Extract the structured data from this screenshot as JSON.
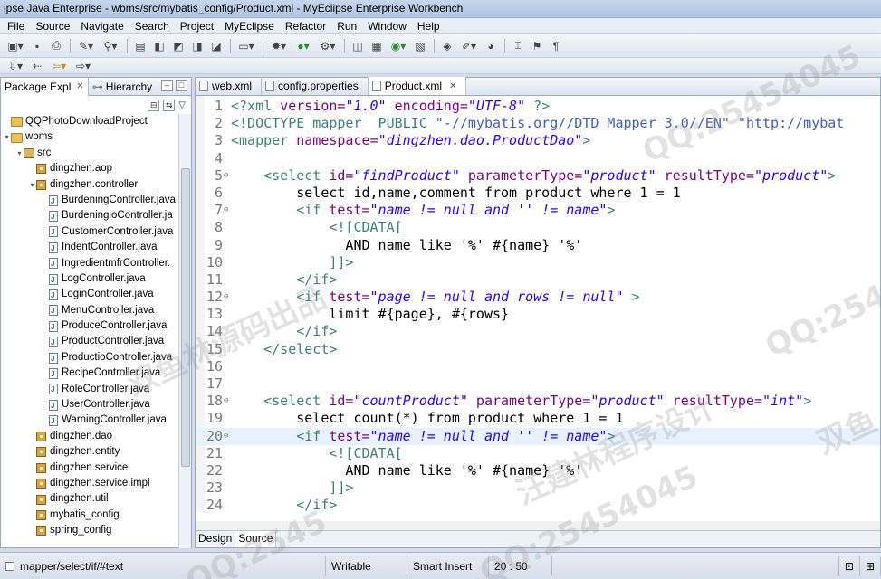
{
  "window": {
    "title": "ipse Java Enterprise - wbms/src/mybatis_config/Product.xml - MyEclipse Enterprise Workbench"
  },
  "menu": [
    "File",
    "Source",
    "Navigate",
    "Search",
    "Project",
    "MyEclipse",
    "Refactor",
    "Run",
    "Window",
    "Help"
  ],
  "left_panel": {
    "tabs": [
      {
        "label": "Package Expl",
        "close": "✕"
      },
      {
        "label": "Hierarchy"
      }
    ],
    "tree": [
      {
        "label": "QQPhotoDownloadProject",
        "indent": 0,
        "icon": "project-icon",
        "twisty": ""
      },
      {
        "label": "wbms",
        "indent": 0,
        "icon": "project-icon",
        "twisty": "▾"
      },
      {
        "label": "src",
        "indent": 1,
        "icon": "source-folder-icon",
        "twisty": "▾"
      },
      {
        "label": "dingzhen.aop",
        "indent": 2,
        "icon": "package-icon",
        "twisty": ""
      },
      {
        "label": "dingzhen.controller",
        "indent": 2,
        "icon": "package-icon",
        "twisty": "▾"
      },
      {
        "label": "BurdeningController.java",
        "indent": 3,
        "icon": "java-file-icon",
        "twisty": ""
      },
      {
        "label": "BurdeningioController.ja",
        "indent": 3,
        "icon": "java-file-icon",
        "twisty": ""
      },
      {
        "label": "CustomerController.java",
        "indent": 3,
        "icon": "java-file-icon",
        "twisty": ""
      },
      {
        "label": "IndentController.java",
        "indent": 3,
        "icon": "java-file-icon",
        "twisty": ""
      },
      {
        "label": "IngredientmfrController.",
        "indent": 3,
        "icon": "java-file-icon",
        "twisty": ""
      },
      {
        "label": "LogController.java",
        "indent": 3,
        "icon": "java-file-icon",
        "twisty": ""
      },
      {
        "label": "LoginController.java",
        "indent": 3,
        "icon": "java-file-icon",
        "twisty": ""
      },
      {
        "label": "MenuController.java",
        "indent": 3,
        "icon": "java-file-icon",
        "twisty": ""
      },
      {
        "label": "ProduceController.java",
        "indent": 3,
        "icon": "java-file-icon",
        "twisty": ""
      },
      {
        "label": "ProductController.java",
        "indent": 3,
        "icon": "java-file-icon",
        "twisty": ""
      },
      {
        "label": "ProductioController.java",
        "indent": 3,
        "icon": "java-file-icon",
        "twisty": ""
      },
      {
        "label": "RecipeController.java",
        "indent": 3,
        "icon": "java-file-icon",
        "twisty": ""
      },
      {
        "label": "RoleController.java",
        "indent": 3,
        "icon": "java-file-icon",
        "twisty": ""
      },
      {
        "label": "UserController.java",
        "indent": 3,
        "icon": "java-file-icon",
        "twisty": ""
      },
      {
        "label": "WarningController.java",
        "indent": 3,
        "icon": "java-file-icon",
        "twisty": ""
      },
      {
        "label": "dingzhen.dao",
        "indent": 2,
        "icon": "package-icon",
        "twisty": ""
      },
      {
        "label": "dingzhen.entity",
        "indent": 2,
        "icon": "package-icon",
        "twisty": ""
      },
      {
        "label": "dingzhen.service",
        "indent": 2,
        "icon": "package-icon",
        "twisty": ""
      },
      {
        "label": "dingzhen.service.impl",
        "indent": 2,
        "icon": "package-icon",
        "twisty": ""
      },
      {
        "label": "dingzhen.util",
        "indent": 2,
        "icon": "package-icon",
        "twisty": ""
      },
      {
        "label": "mybatis_config",
        "indent": 2,
        "icon": "package-icon",
        "twisty": ""
      },
      {
        "label": "spring_config",
        "indent": 2,
        "icon": "package-icon",
        "twisty": ""
      }
    ]
  },
  "editor": {
    "tabs": [
      {
        "label": "web.xml",
        "active": false
      },
      {
        "label": "config.properties",
        "active": false
      },
      {
        "label": "Product.xml",
        "active": true,
        "close": "✕"
      }
    ],
    "highlighted_line": 20,
    "lines": [
      {
        "n": "1",
        "fold": "",
        "tokens": [
          [
            "t-pi",
            "<?xml "
          ],
          [
            "t-attr",
            "version="
          ],
          [
            "t-str",
            "\"1.0\""
          ],
          [
            "t-attr",
            " encoding="
          ],
          [
            "t-str",
            "\"UTF-8\""
          ],
          [
            "t-pi",
            " ?>"
          ]
        ]
      },
      {
        "n": "2",
        "fold": "",
        "tokens": [
          [
            "t-doc",
            "<!DOCTYPE mapper  PUBLIC "
          ],
          [
            "t-docs",
            "\"-//mybatis.org//DTD Mapper 3.0//EN\""
          ],
          [
            "t-doc",
            " "
          ],
          [
            "t-docs",
            "\"http://mybat"
          ]
        ]
      },
      {
        "n": "3",
        "fold": "",
        "tokens": [
          [
            "t-tag",
            "<mapper "
          ],
          [
            "t-attr",
            "namespace="
          ],
          [
            "t-str",
            "\"dingzhen.dao.ProductDao\""
          ],
          [
            "t-tag",
            ">"
          ]
        ]
      },
      {
        "n": "4",
        "fold": "",
        "tokens": []
      },
      {
        "n": "5",
        "fold": "⊖",
        "tokens": [
          [
            "t-tag",
            "    <select "
          ],
          [
            "t-attr",
            "id="
          ],
          [
            "t-str",
            "\"findProduct\""
          ],
          [
            "t-attr",
            " parameterType="
          ],
          [
            "t-str",
            "\"product\""
          ],
          [
            "t-attr",
            " resultType="
          ],
          [
            "t-str",
            "\"product\""
          ],
          [
            "t-tag",
            ">"
          ]
        ]
      },
      {
        "n": "6",
        "fold": "",
        "tokens": [
          [
            "t-txt",
            "        select id,name,comment from product where 1 = 1"
          ]
        ]
      },
      {
        "n": "7",
        "fold": "⊖",
        "tokens": [
          [
            "t-tag",
            "        <if "
          ],
          [
            "t-attr",
            "test="
          ],
          [
            "t-str",
            "\"name != null and '' != name\""
          ],
          [
            "t-tag",
            ">"
          ]
        ]
      },
      {
        "n": "8",
        "fold": "",
        "tokens": [
          [
            "t-cdata",
            "            <![CDATA["
          ]
        ]
      },
      {
        "n": "9",
        "fold": "",
        "tokens": [
          [
            "t-txt",
            "              AND name like '%' #{name} '%'"
          ]
        ]
      },
      {
        "n": "10",
        "fold": "",
        "tokens": [
          [
            "t-cdata",
            "            ]]>"
          ]
        ]
      },
      {
        "n": "11",
        "fold": "",
        "tokens": [
          [
            "t-tag",
            "        </if>"
          ]
        ]
      },
      {
        "n": "12",
        "fold": "⊖",
        "tokens": [
          [
            "t-tag",
            "        <if "
          ],
          [
            "t-attr",
            "test="
          ],
          [
            "t-str",
            "\"page != null and rows != null\""
          ],
          [
            "t-tag",
            " >"
          ]
        ]
      },
      {
        "n": "13",
        "fold": "",
        "tokens": [
          [
            "t-txt",
            "            limit #{page}, #{rows}"
          ]
        ]
      },
      {
        "n": "14",
        "fold": "",
        "tokens": [
          [
            "t-tag",
            "        </if>"
          ]
        ]
      },
      {
        "n": "15",
        "fold": "",
        "tokens": [
          [
            "t-tag",
            "    </select>"
          ]
        ]
      },
      {
        "n": "16",
        "fold": "",
        "tokens": []
      },
      {
        "n": "17",
        "fold": "",
        "tokens": []
      },
      {
        "n": "18",
        "fold": "⊖",
        "tokens": [
          [
            "t-tag",
            "    <select "
          ],
          [
            "t-attr",
            "id="
          ],
          [
            "t-str",
            "\"countProduct\""
          ],
          [
            "t-attr",
            " parameterType="
          ],
          [
            "t-str",
            "\"product\""
          ],
          [
            "t-attr",
            " resultType="
          ],
          [
            "t-str",
            "\"int\""
          ],
          [
            "t-tag",
            ">"
          ]
        ]
      },
      {
        "n": "19",
        "fold": "",
        "tokens": [
          [
            "t-txt",
            "        select count(*) from product where 1 = 1"
          ]
        ]
      },
      {
        "n": "20",
        "fold": "⊖",
        "tokens": [
          [
            "t-tag",
            "        <if "
          ],
          [
            "t-attr",
            "test="
          ],
          [
            "t-str",
            "\"name != null and '' != name\""
          ],
          [
            "t-tag",
            ">"
          ]
        ]
      },
      {
        "n": "21",
        "fold": "",
        "tokens": [
          [
            "t-cdata",
            "            <![CDATA["
          ]
        ]
      },
      {
        "n": "22",
        "fold": "",
        "tokens": [
          [
            "t-txt",
            "              AND name like '%' #{name} '%'"
          ]
        ]
      },
      {
        "n": "23",
        "fold": "",
        "tokens": [
          [
            "t-cdata",
            "            ]]>"
          ]
        ]
      },
      {
        "n": "24",
        "fold": "",
        "tokens": [
          [
            "t-tag",
            "        </if>"
          ]
        ]
      }
    ],
    "bottom_tabs": [
      "Design",
      "Source"
    ]
  },
  "status": {
    "path": "mapper/select/if/#text",
    "writable": "Writable",
    "insert_mode": "Smart Insert",
    "position": "20 : 50"
  },
  "watermarks": [
    "QQ:25454045",
    "QQ:2545",
    "双鱼林源码出品",
    "汪建林程序设计",
    "QQ:2545",
    "双鱼",
    "QQ:25454045"
  ]
}
